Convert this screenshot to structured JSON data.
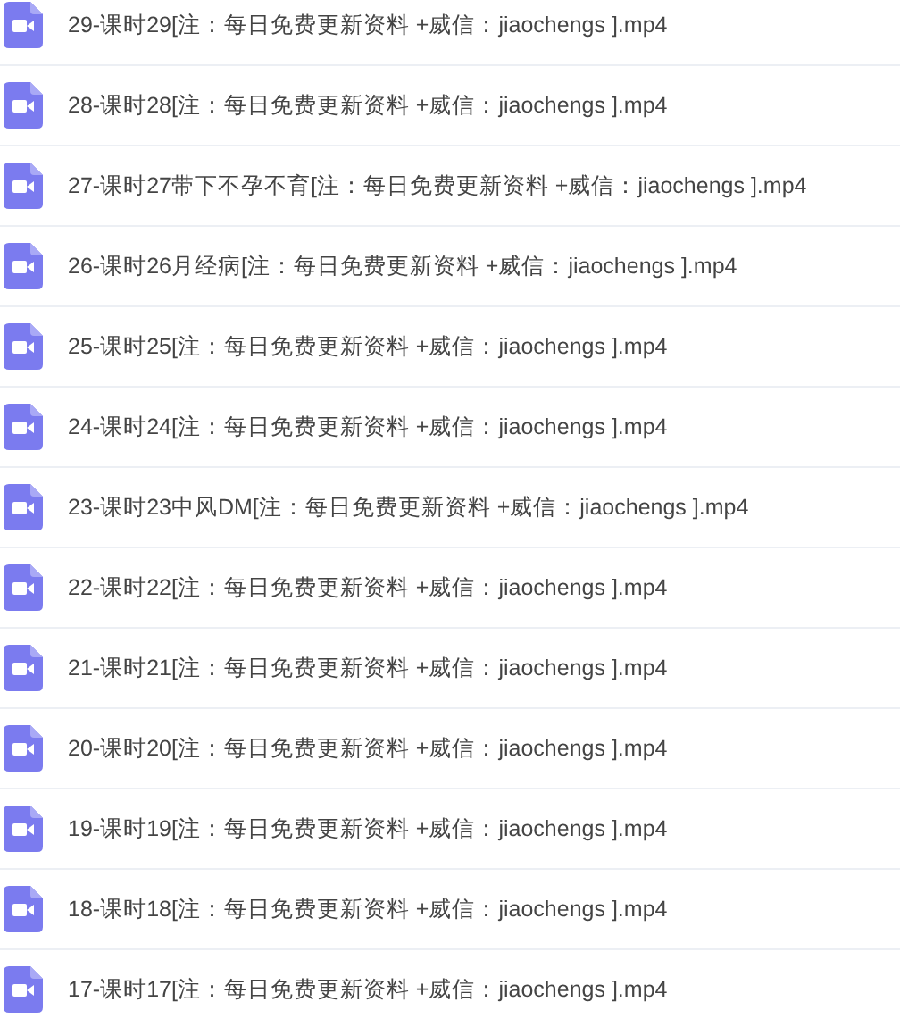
{
  "files": [
    {
      "name": "29-课时29[注：每日免费更新资料 +威信：jiaochengs ].mp4"
    },
    {
      "name": "28-课时28[注：每日免费更新资料 +威信：jiaochengs ].mp4"
    },
    {
      "name": "27-课时27带下不孕不育[注：每日免费更新资料 +威信：jiaochengs ].mp4"
    },
    {
      "name": "26-课时26月经病[注：每日免费更新资料 +威信：jiaochengs ].mp4"
    },
    {
      "name": "25-课时25[注：每日免费更新资料 +威信：jiaochengs ].mp4"
    },
    {
      "name": "24-课时24[注：每日免费更新资料 +威信：jiaochengs ].mp4"
    },
    {
      "name": "23-课时23中风DM[注：每日免费更新资料 +威信：jiaochengs ].mp4"
    },
    {
      "name": "22-课时22[注：每日免费更新资料 +威信：jiaochengs ].mp4"
    },
    {
      "name": "21-课时21[注：每日免费更新资料 +威信：jiaochengs ].mp4"
    },
    {
      "name": "20-课时20[注：每日免费更新资料 +威信：jiaochengs ].mp4"
    },
    {
      "name": "19-课时19[注：每日免费更新资料 +威信：jiaochengs ].mp4"
    },
    {
      "name": "18-课时18[注：每日免费更新资料 +威信：jiaochengs ].mp4"
    },
    {
      "name": "17-课时17[注：每日免费更新资料 +威信：jiaochengs ].mp4"
    }
  ]
}
